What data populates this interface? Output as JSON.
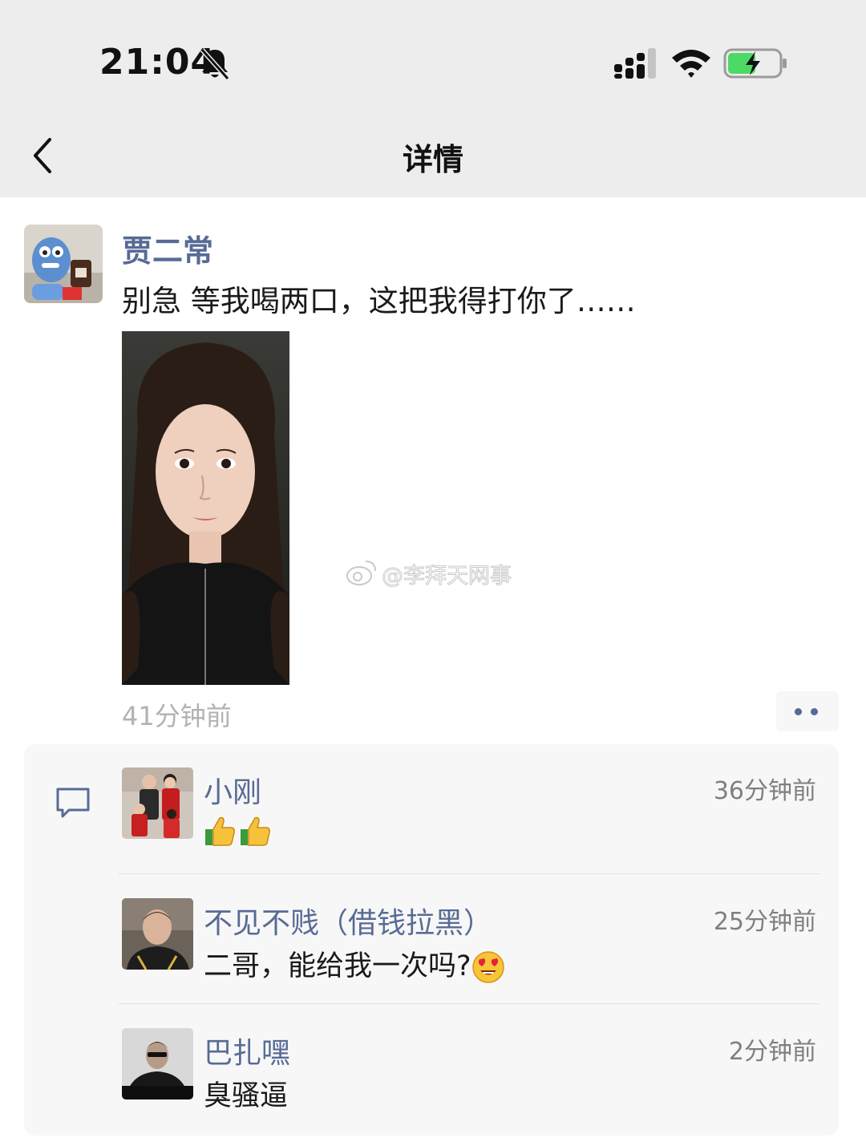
{
  "status_bar": {
    "time": "21:04",
    "icons": [
      "bell-muted-icon",
      "signal-icon",
      "wifi-icon",
      "battery-charging-icon"
    ]
  },
  "nav": {
    "title": "详情",
    "back_icon": "chevron-left-icon"
  },
  "post": {
    "author": "贾二常",
    "text": "别急 等我喝两口，这把我得打你了……",
    "photo": "selfie-photo",
    "time": "41分钟前",
    "watermark": "@李拜天网事"
  },
  "comments": [
    {
      "name": "小刚",
      "time": "36分钟前",
      "text": "",
      "emoji": [
        "thumbs-up",
        "thumbs-up"
      ]
    },
    {
      "name": "不见不贱（借钱拉黑）",
      "time": "25分钟前",
      "text": "二哥，能给我一次吗?",
      "emoji": [
        "heart-eyes-face"
      ]
    },
    {
      "name": "巴扎嘿",
      "time": "2分钟前",
      "text": "臭骚逼",
      "emoji": []
    }
  ],
  "colors": {
    "bar_bg": "#ededed",
    "link_blue": "#576b95",
    "comment_bg": "#f7f7f7",
    "muted_text": "#b2b2b2"
  }
}
